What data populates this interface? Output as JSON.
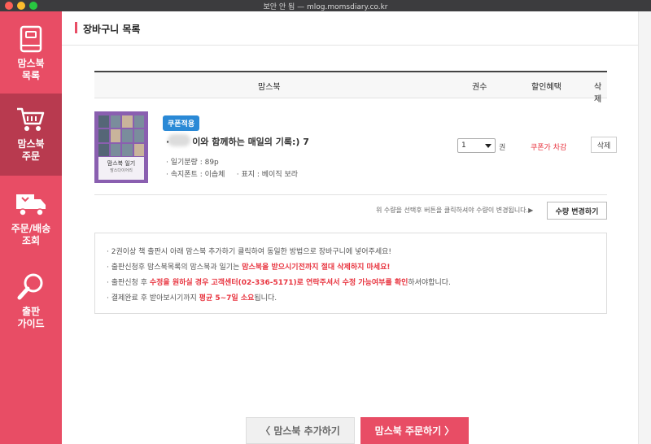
{
  "window": {
    "title": "보안 안 됨 — mlog.momsdiary.co.kr"
  },
  "sidebar": {
    "items": [
      {
        "label": "맘스북\n목록",
        "icon": "book-icon"
      },
      {
        "label": "맘스북\n주문",
        "icon": "cart-icon",
        "active": true
      },
      {
        "label": "주문/배송\n조회",
        "icon": "truck-icon"
      },
      {
        "label": "출판\n가이드",
        "icon": "magnifier-icon"
      }
    ]
  },
  "page": {
    "title": "장바구니 목록"
  },
  "table": {
    "headers": {
      "book": "맘스북",
      "qty": "권수",
      "discount": "할인혜택",
      "delete": "삭제"
    }
  },
  "cart_item": {
    "cover_title": "맘스북 일기",
    "cover_subtitle": "맘스다이어리",
    "coupon_badge": "쿠폰적용",
    "title_prefix": "·",
    "title": "이와 함께하는 매일의 기록:) 7",
    "pages": "· 일기분량 : 89p",
    "font_cover": "· 속지폰트 : 이솝체     · 표지 : 베이직 보라",
    "qty_value": "1",
    "qty_unit": "권",
    "discount": "쿠폰가 차감",
    "delete_label": "삭제"
  },
  "qty_notice": "위 수량을 선택후 버튼을 클릭하셔야 수량이 변경됩니다.▶",
  "qty_change_label": "수량 변경하기",
  "info": [
    {
      "a": "· 2권이상 책 출판시 아래 맘스북 추가하기 클릭하여 동일한 방법으로 장바구니에 넣어주세요!",
      "hl": "",
      "b": ""
    },
    {
      "a": "· 출판신청후 맘스북목록의 맘스북과 일기는 ",
      "hl": "맘스북을 받으시기전까지 절대 삭제하지 마세요!",
      "b": ""
    },
    {
      "a": "· 출판신청 후 ",
      "hl": "수정을 원하실 경우 고객센터(02-336-5171)로 연락주셔서 수정 가능여부를 확인",
      "b": "하셔야합니다."
    },
    {
      "a": "· 결제완료 후 받아보시기까지 ",
      "hl": "평균 5~7일 소요",
      "b": "됩니다."
    }
  ],
  "buttons": {
    "add": "〈 맘스북 추가하기",
    "order": "맘스북 주문하기 〉"
  },
  "colors": {
    "brand": "#e84d65",
    "brand_dark": "#b83a4f",
    "highlight": "#e8343f",
    "badge": "#2a89d6"
  }
}
